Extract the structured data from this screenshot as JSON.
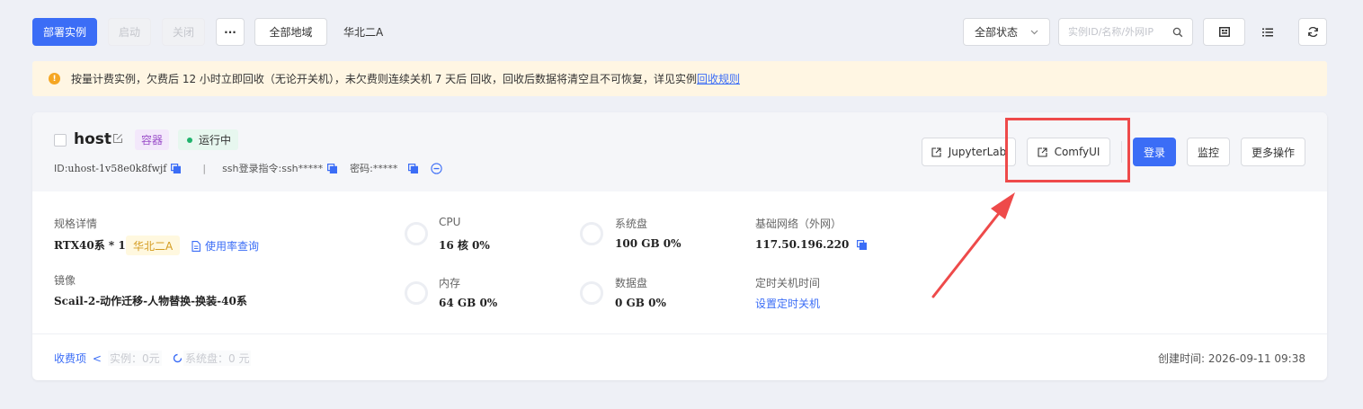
{
  "toolbar": {
    "deploy_label": "部署实例",
    "start_label": "启动",
    "stop_label": "关闭",
    "more_label": "···",
    "region_filter_label": "全部地域",
    "current_region": "华北二A",
    "status_filter_label": "全部状态",
    "search_placeholder": "实例ID/名称/外网IP"
  },
  "notice": {
    "text": "按量计费实例，欠费后 12 小时立即回收（无论开关机），未欠费则连续关机 7 天后 回收，回收后数据将清空且不可恢复，详见实例",
    "link_label": "回收规则",
    "accent_color": "#f5a623"
  },
  "instance": {
    "name": "host",
    "type_tag": "容器",
    "status": "运行中",
    "id_label": "ID: ",
    "id_value": "uhost-1v58e0k8fwjf",
    "separator": "|",
    "ssh_label": "ssh登录指令: ",
    "ssh_value": "ssh*****",
    "password_label": "密码: ",
    "password_value": "*****",
    "actions": {
      "jupyter_label": "JupyterLab",
      "comfy_label": "ComfyUI",
      "login_label": "登录",
      "monitor_label": "监控",
      "more_label": "更多操作"
    },
    "spec": {
      "spec_label": "规格详情",
      "spec_value": "RTX40系 * 1",
      "region_tag": "华北二A",
      "usage_link": "使用率查询",
      "image_label": "镜像",
      "image_value": "Scail-2-动作迁移-人物替换-换装-40系"
    },
    "metrics": {
      "cpu_label": "CPU",
      "cpu_value": "16 核 0%",
      "memory_label": "内存",
      "memory_value": "64 GB 0%",
      "system_disk_label": "系统盘",
      "system_disk_value": "100 GB 0%",
      "data_disk_label": "数据盘",
      "data_disk_value": "0 GB 0%"
    },
    "network": {
      "network_label": "基础网络（外网）",
      "ip_value": "117.50.196.220",
      "schedule_label": "定时关机时间",
      "schedule_link": "设置定时关机"
    },
    "footer": {
      "billing_link": "收费项",
      "billing_chevron": "<",
      "instance_cost": "实例：0元",
      "disk_cost": "系统盘：0 元",
      "created_label": "创建时间: ",
      "created_value": "2026-09-11 09:38"
    }
  },
  "colors": {
    "primary": "#3b6df6",
    "running_dot": "#1fb36c",
    "annotation_red": "#ee4a4a"
  }
}
